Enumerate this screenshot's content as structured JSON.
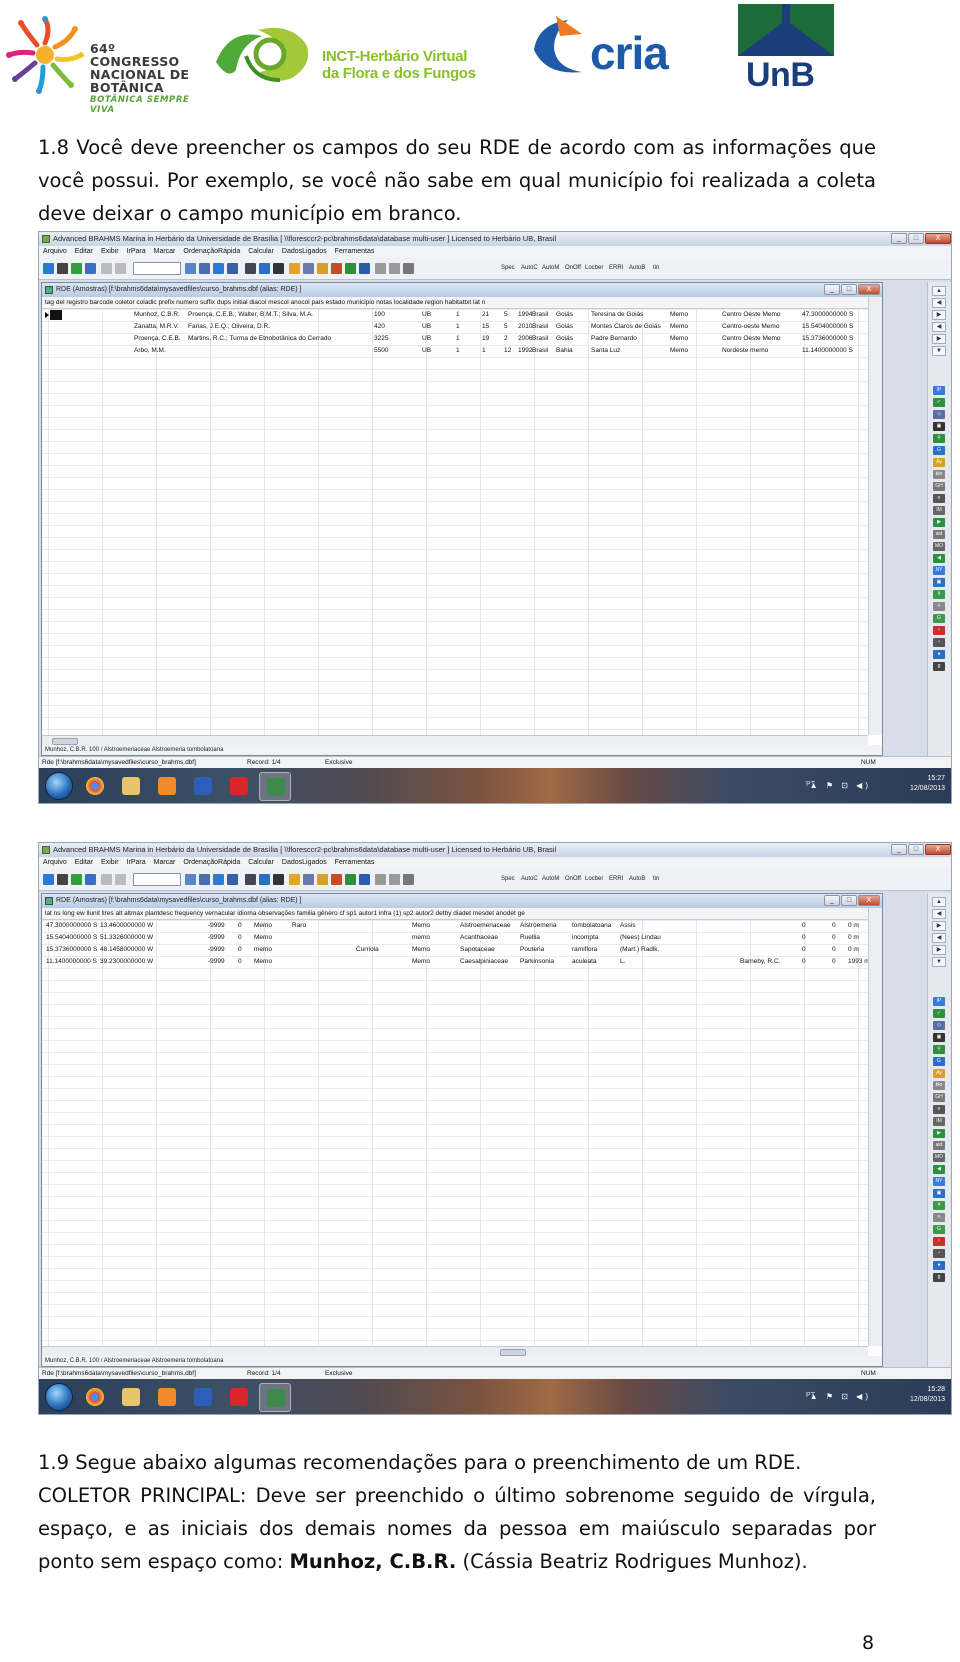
{
  "header": {
    "congress_lines": [
      "64º CONGRESSO",
      "NACIONAL DE",
      "BOTÂNICA"
    ],
    "congress_tagline": "BOTÂNICA SEMPRE VIVA",
    "inct_lines": [
      "INCT-Herbário Virtual",
      "da Flora e dos Fungos"
    ],
    "cria": "cria",
    "unb": "UnB"
  },
  "para1": "1.8 Você deve preencher os campos do seu RDE de acordo com as informações que você possui. Por exemplo, se você não sabe em qual município foi realizada a coleta deve deixar o campo município em branco.",
  "para2": {
    "line1": "1.9 Segue abaixo algumas recomendações para o preenchimento de um RDE.",
    "line2_prefix": "COLETOR PRINCIPAL: Deve ser preenchido o último sobrenome seguido de vírgula, espaço, e as iniciais dos demais nomes da pessoa em maiúsculo separadas por ponto sem espaço como: ",
    "bold": "Munhoz, C.B.R.",
    "line2_suffix": " (Cássia Beatriz Rodrigues Munhoz)."
  },
  "page_number": "8",
  "app": {
    "title": "Advanced BRAHMS    Marina in Herbário da Universidade de Brasília [ \\\\floresccr2-pc\\brahms6data\\database  multi-user ]    Licensed to Herbário UB, Brasil",
    "menu": [
      "Arquivo",
      "Editar",
      "Exibir",
      "IrPara",
      "Marcar",
      "OrdenaçãoRápida",
      "Calcular",
      "DadosLigados",
      "Ferramentas"
    ],
    "toolbar_text": [
      "Spec",
      "AutoC",
      "AutoM",
      "OnOff",
      "Locber",
      "ERRI",
      "AutoB",
      "tin"
    ],
    "window_buttons": [
      "_",
      "□",
      "X"
    ],
    "mdi_title": "RDE (Amostras) [f:\\brahms6data\\mysavedfiles\\curso_brahms.dbf (alias: RDE) ]",
    "mdi_status": "Munhoz, C.B.R.    100   /   Alstroemeriaceae  Alstroemeria tombolatoana",
    "status_path": "Rde [f:\\brahms6data\\mysavedfiles\\curso_brahms.dbf]",
    "status_record": "Record: 1/4",
    "status_mode": "Exclusive",
    "status_num": "NUM",
    "tray_lang": "PT",
    "tray_icons": "▲ ⚑ ⊡ ◀)",
    "right_panel_arrows": [
      "▲",
      "◀",
      "▶",
      "◀",
      "▶",
      "▼"
    ],
    "right_panel_icons": [
      "IP",
      "✓",
      "◇",
      "▣",
      "⚲",
      "G",
      "Ay",
      "blo",
      "GH",
      "≡",
      "IM",
      "▶",
      "aid",
      "MO",
      "◀",
      "NY",
      "▣",
      "⚘",
      "≡",
      "G",
      "♀",
      "♂",
      "●",
      "g"
    ]
  },
  "shot1": {
    "header": "tag  del  registro  barcode  coletor                 coladic                                                     prefix  numero  suffix  dups  initial  diacol  mescol  anocol  país     estado  municipio                          notas  localidade  region          habitattxt  lat                  n",
    "columns_x": [
      90,
      144,
      330,
      380,
      412,
      452,
      470,
      490,
      513,
      550,
      600,
      630,
      670,
      720
    ],
    "rows": [
      [
        "Munhoz, C.B.R.",
        "Proença, C.E.B.; Walter, B.M.T.; Silva, M.A.",
        "100",
        "UB",
        "1",
        "21",
        "5",
        "1994",
        "Brasil",
        "Goiás",
        "Teresina de Goiás",
        "Memo",
        "Centro Oeste  Memo",
        "47.3000000000 S"
      ],
      [
        "Zanatta, M.R.V.",
        "Farias, J.E.Q.; Oliveira, D.R.",
        "420",
        "UB",
        "1",
        "15",
        "5",
        "2010",
        "Brasil",
        "Goiás",
        "Montes Claros de Goiás",
        "Memo",
        "Centro-oeste  Memo",
        "15.5404000000 S"
      ],
      [
        "Proença, C.E.B.",
        "Martins, R.C.; Turma de Etnobotânica do Cerrado",
        "3225",
        "UB",
        "1",
        "19",
        "2",
        "2006",
        "Brasil",
        "Goiás",
        "Padre Bernardo",
        "Memo",
        "Centro Oeste  Memo",
        "15.3736000000 S"
      ],
      [
        "Arbo, M.M.",
        "",
        "5500",
        "UB",
        "1",
        "1",
        "12",
        "1992",
        "Brasil",
        "Bahia",
        "Santa Luz",
        "Memo",
        "Nordeste      memo",
        "11.1400000000 S"
      ]
    ],
    "clock_time": "15:27",
    "clock_date": "12/08/2013"
  },
  "shot2": {
    "header": "lat                       ns  long                      ew  llunit  llres  alt      altmax  plantdesc  frequency  vernacular  idioma  observações  familia                  gênero       cf  sp1            autor1                    infra (1)  sp2  autor2  detby              diadet  mesdet  anodet  ge",
    "rows": [
      [
        "47.3000000000 S",
        "13.4600000000 W",
        "-9999",
        "0",
        "Memo",
        "Raro",
        "",
        "Memo",
        "Alstroemeriaceae",
        "Alstroemeria",
        "tombolatoana",
        "Assis",
        "",
        "0",
        "0",
        "0 m"
      ],
      [
        "15.5404000000 S",
        "51.3326000000 W",
        "-9999",
        "0",
        "Memo",
        "",
        "",
        "memo",
        "Acanthaceae",
        "Ruellia",
        "incompta",
        "(Nees) Lindau",
        "",
        "0",
        "0",
        "0 m"
      ],
      [
        "15.3736000000 S",
        "48.1458000000 W",
        "-9999",
        "0",
        "memo",
        "",
        "Curriola",
        "Memo",
        "Sapotaceae",
        "Pouteria",
        "ramiflora",
        "(Mart.) Radlk.",
        "",
        "0",
        "0",
        "0 m"
      ],
      [
        "11.1400000000 S",
        "39.2300000000 W",
        "-9999",
        "0",
        "Memo",
        "",
        "",
        "Memo",
        "Caesalpiniaceae",
        "Parkinsonia",
        "aculeata",
        "L.",
        "Barneby, R.C.",
        "0",
        "0",
        "1993 m"
      ]
    ],
    "clock_time": "15:28",
    "clock_date": "12/08/2013"
  },
  "colors": {
    "cria_blue": "#1f5aa8",
    "cria_orange": "#f07a22",
    "unb_green": "#1e6b3a",
    "unb_blue": "#1b3d7a",
    "inct_green": "#8abf2c"
  }
}
